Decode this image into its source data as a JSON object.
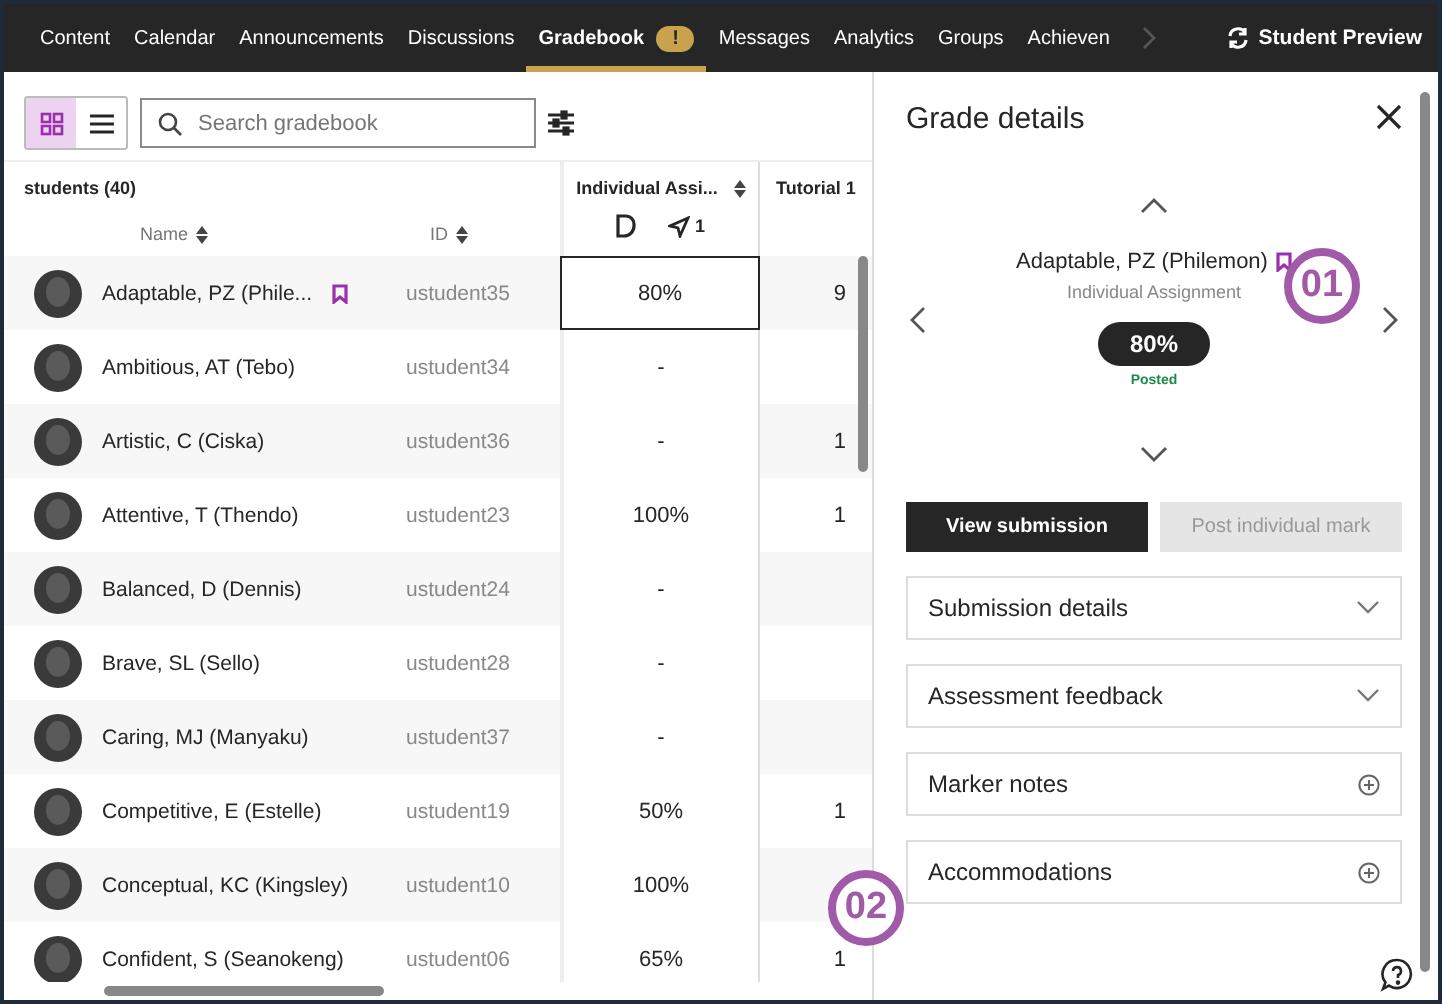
{
  "nav": {
    "tabs": [
      {
        "label": "Content",
        "selected": false
      },
      {
        "label": "Calendar",
        "selected": false
      },
      {
        "label": "Announcements",
        "selected": false
      },
      {
        "label": "Discussions",
        "selected": false
      },
      {
        "label": "Gradebook",
        "selected": true,
        "badge": "!"
      },
      {
        "label": "Messages",
        "selected": false
      },
      {
        "label": "Analytics",
        "selected": false
      },
      {
        "label": "Groups",
        "selected": false
      },
      {
        "label": "Achieven",
        "selected": false
      }
    ],
    "student_preview": "Student Preview"
  },
  "toolbar": {
    "views": [
      {
        "kind": "grid",
        "selected": true
      },
      {
        "kind": "list",
        "selected": false
      }
    ],
    "search": {
      "placeholder": "Search gradebook"
    }
  },
  "table": {
    "count_label": "students (40)",
    "name_header": "Name",
    "id_header": "ID",
    "columns": [
      {
        "title": "Individual Assi...",
        "submissions": "1"
      },
      {
        "title": "Tutorial 1"
      }
    ],
    "rows": [
      {
        "name": "Adaptable, PZ (Phile...",
        "flagged": true,
        "id": "ustudent35",
        "grade": "80%",
        "column_2": "9",
        "selected": true
      },
      {
        "name": "Ambitious, AT (Tebo)",
        "flagged": false,
        "id": "ustudent34",
        "grade": "-",
        "selected": false
      },
      {
        "name": "Artistic, C (Ciska)",
        "flagged": false,
        "id": "ustudent36",
        "grade": "-",
        "column_2": "1",
        "selected": false
      },
      {
        "name": "Attentive, T (Thendo)",
        "flagged": false,
        "id": "ustudent23",
        "grade": "100%",
        "column_2": "1",
        "selected": false
      },
      {
        "name": "Balanced, D (Dennis)",
        "flagged": false,
        "id": "ustudent24",
        "grade": "-",
        "selected": false
      },
      {
        "name": "Brave, SL (Sello)",
        "flagged": false,
        "id": "ustudent28",
        "grade": "-",
        "selected": false
      },
      {
        "name": "Caring, MJ (Manyaku)",
        "flagged": false,
        "id": "ustudent37",
        "grade": "-",
        "selected": false
      },
      {
        "name": "Competitive, E (Estelle)",
        "flagged": false,
        "id": "ustudent19",
        "grade": "50%",
        "column_2": "1",
        "selected": false
      },
      {
        "name": "Conceptual, KC (Kingsley)",
        "flagged": false,
        "id": "ustudent10",
        "grade": "100%",
        "selected": false
      },
      {
        "name": "Confident, S (Seanokeng)",
        "flagged": false,
        "id": "ustudent06",
        "grade": "65%",
        "column_2": "1",
        "selected": false
      }
    ]
  },
  "details": {
    "title": "Grade details",
    "student": "Adaptable, PZ (Philemon)",
    "flagged": true,
    "assignment": "Individual Assignment",
    "grade": "80%",
    "status": "Posted",
    "buttons": [
      {
        "label": "View submission",
        "disabled": false
      },
      {
        "label": "Post individual mark",
        "disabled": true
      }
    ],
    "sections": [
      {
        "label": "Submission details",
        "kind": "dropdown"
      },
      {
        "label": "Assessment feedback",
        "kind": "dropdown"
      },
      {
        "label": "Marker notes",
        "kind": "add"
      },
      {
        "label": "Accommodations",
        "kind": "add"
      }
    ]
  },
  "callouts": [
    "01",
    "02"
  ]
}
